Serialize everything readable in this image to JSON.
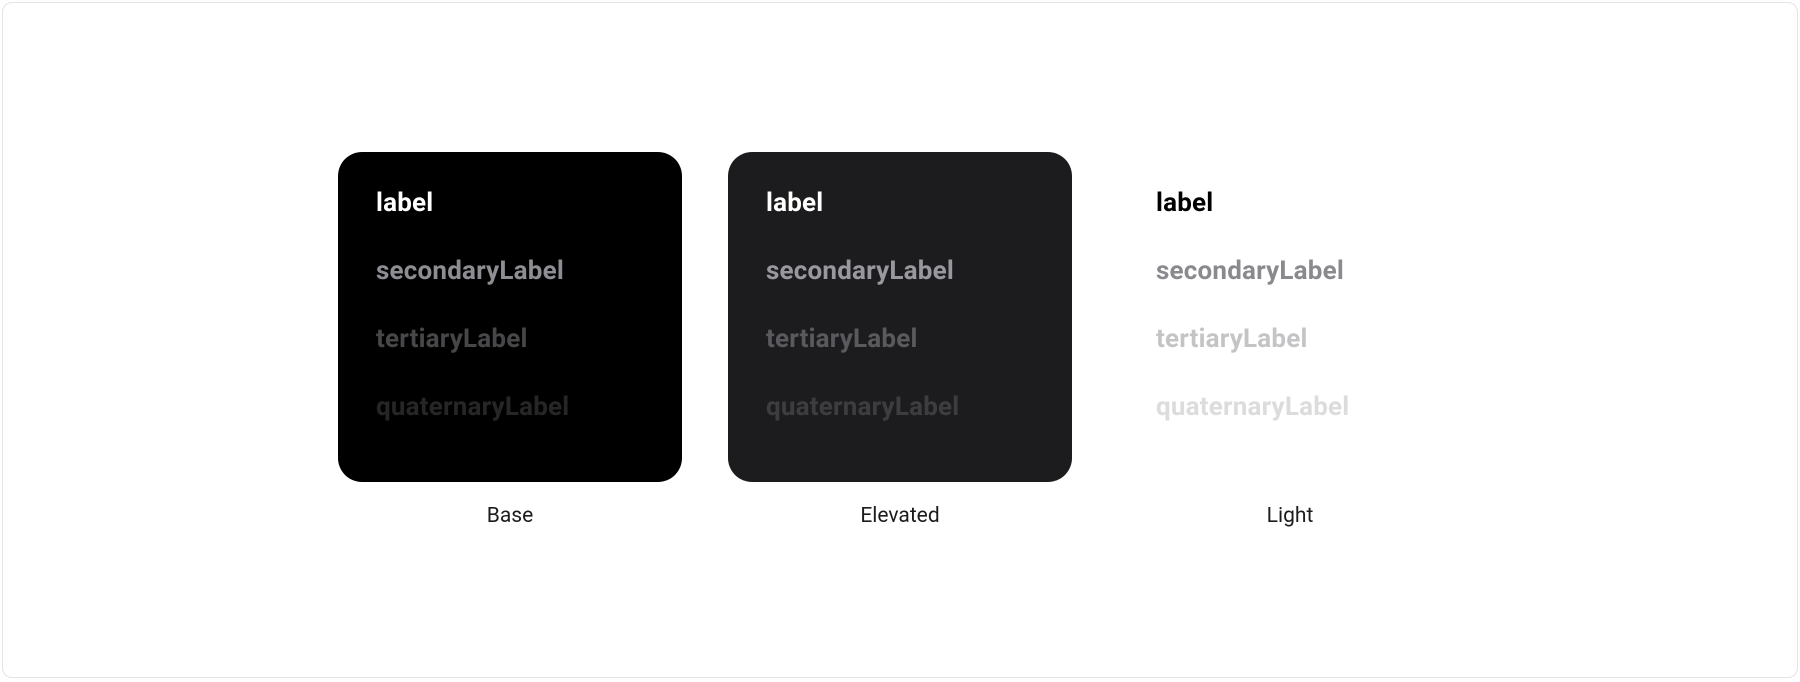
{
  "labels": {
    "primary": "label",
    "secondary": "secondaryLabel",
    "tertiary": "tertiaryLabel",
    "quaternary": "quaternaryLabel"
  },
  "variants": {
    "base": {
      "caption": "Base"
    },
    "elevated": {
      "caption": "Elevated"
    },
    "light": {
      "caption": "Light"
    }
  }
}
